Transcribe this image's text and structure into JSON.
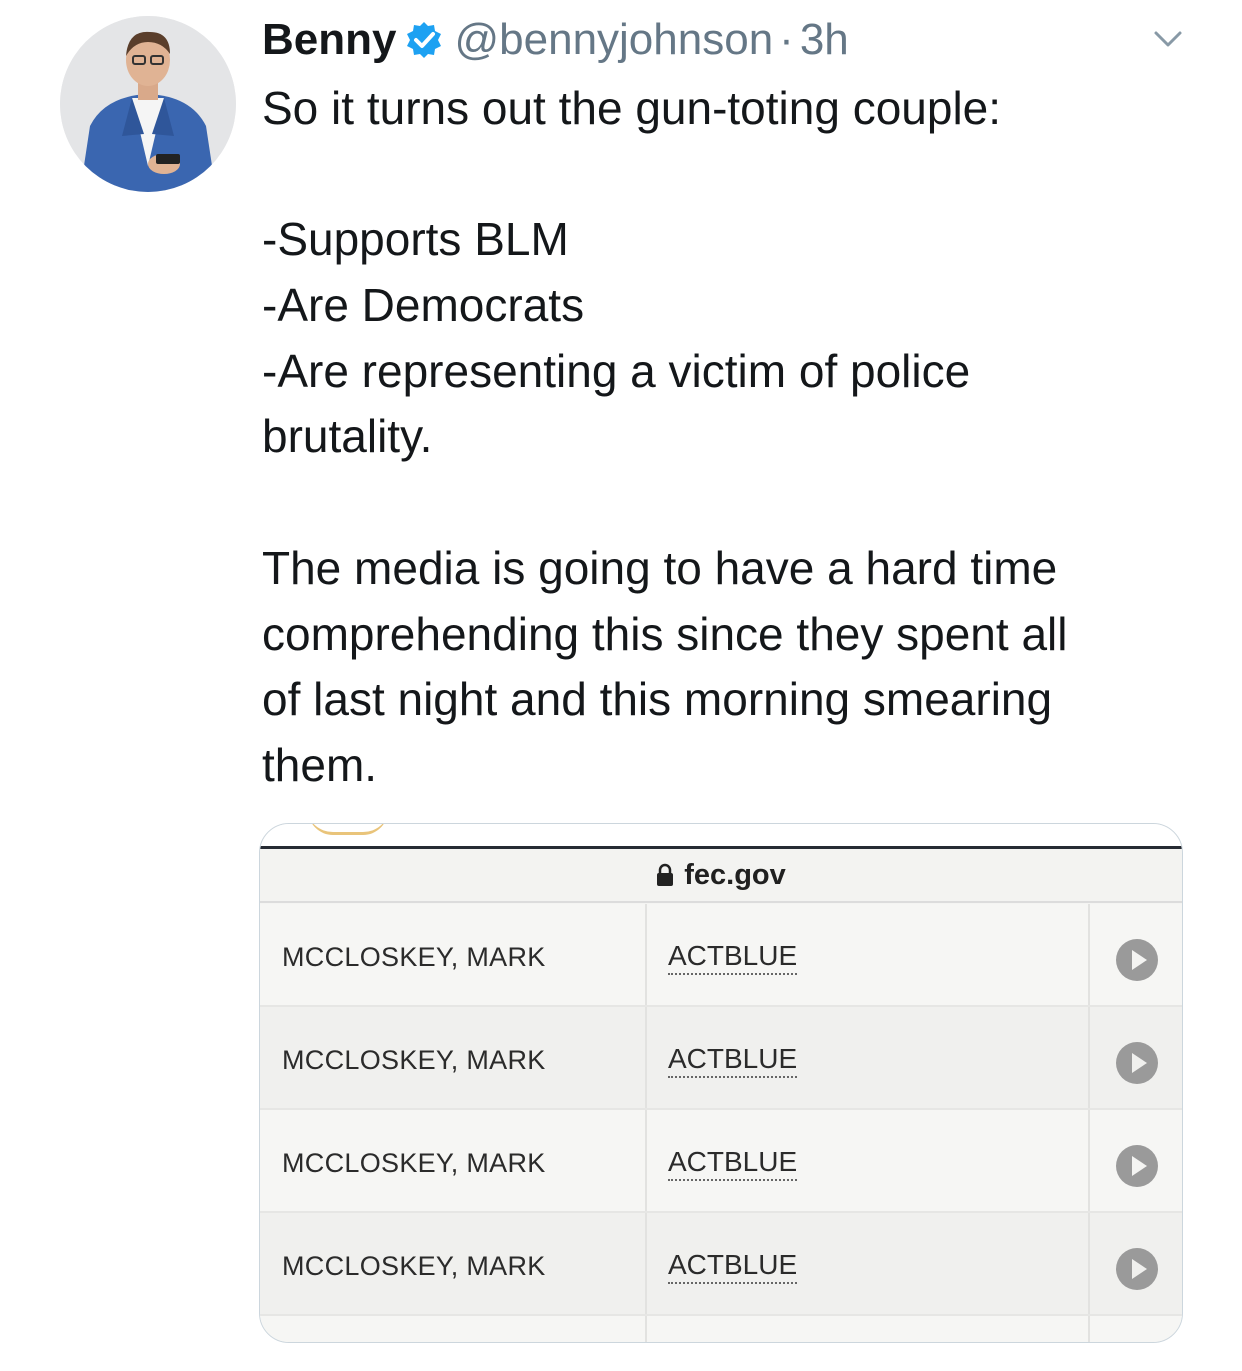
{
  "tweet": {
    "author_name": "Benny",
    "handle": "@bennyjohnson",
    "separator": "·",
    "time": "3h",
    "text_lines": [
      "So it turns out the gun-toting couple:",
      "",
      "-Supports BLM",
      "-Are Democrats",
      "-Are representing a victim of police",
      "brutality.",
      "",
      "The media is going to have a hard time",
      "comprehending this since they spent all",
      "of last night and this morning smearing",
      "them."
    ]
  },
  "attachment": {
    "address_bar": "fec.gov",
    "rows": [
      {
        "name": "MCCLOSKEY, MARK",
        "committee": "ACTBLUE"
      },
      {
        "name": "MCCLOSKEY, MARK",
        "committee": "ACTBLUE"
      },
      {
        "name": "MCCLOSKEY, MARK",
        "committee": "ACTBLUE"
      },
      {
        "name": "MCCLOSKEY, MARK",
        "committee": "ACTBLUE"
      }
    ]
  },
  "icons": {
    "verified": "verified-badge-icon",
    "menu": "chevron-down-icon",
    "lock": "lock-icon",
    "row_action": "play-circle-icon"
  },
  "colors": {
    "verified_blue": "#1da1f2",
    "muted_text": "#657786",
    "primary_text": "#14171a"
  }
}
